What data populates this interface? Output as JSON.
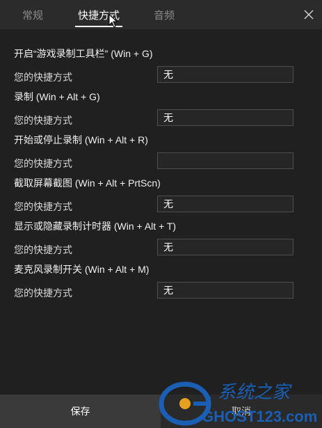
{
  "tabs": [
    {
      "label": "常规"
    },
    {
      "label": "快捷方式"
    },
    {
      "label": "音频"
    }
  ],
  "sections": [
    {
      "title": "开启“游戏录制工具栏” (Win + G)",
      "row_label": "您的快捷方式",
      "value": "无"
    },
    {
      "title": "录制 (Win + Alt + G)",
      "row_label": "您的快捷方式",
      "value": "无"
    },
    {
      "title": "开始或停止录制 (Win + Alt + R)",
      "row_label": "您的快捷方式",
      "value": ""
    },
    {
      "title": "截取屏幕截图 (Win + Alt + PrtScn)",
      "row_label": "您的快捷方式",
      "value": "无"
    },
    {
      "title": "显示或隐藏录制计时器 (Win + Alt + T)",
      "row_label": "您的快捷方式",
      "value": "无"
    },
    {
      "title": "麦克风录制开关 (Win + Alt + M)",
      "row_label": "您的快捷方式",
      "value": "无"
    }
  ],
  "footer": {
    "save_label": "保存",
    "cancel_label": "取消"
  },
  "watermark": {
    "brand_cn": "系统之家",
    "brand_en": "GHOST123.com"
  },
  "colors": {
    "background": "#202020",
    "accent": "#ffffff",
    "watermark_blue": "#1a5fb4"
  }
}
